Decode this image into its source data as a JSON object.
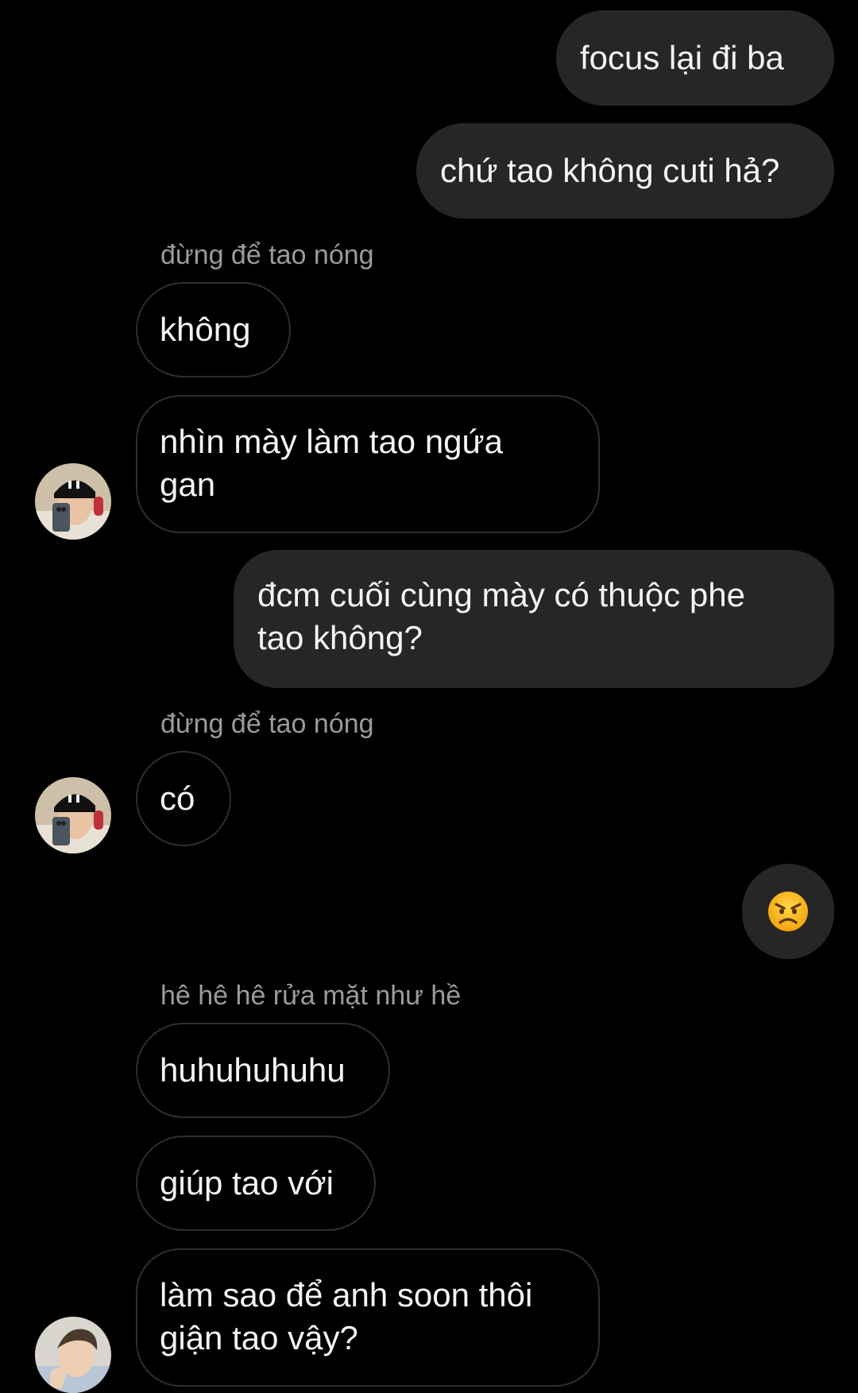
{
  "chat": {
    "messages": [
      {
        "id": "m1",
        "direction": "outgoing",
        "text": "focus lại đi ba"
      },
      {
        "id": "m2",
        "direction": "outgoing",
        "text": "chứ tao không cuti hả?"
      },
      {
        "id": "m3",
        "direction": "incoming",
        "sender": "đừng để tao nóng",
        "text": "không"
      },
      {
        "id": "m4",
        "direction": "incoming",
        "text_line1": "nhìn mày làm tao ngứa",
        "text_line2": "gan"
      },
      {
        "id": "m5",
        "direction": "outgoing",
        "text_line1": "đcm cuối cùng mày có thuộc phe",
        "text_line2": "tao không?"
      },
      {
        "id": "m6",
        "direction": "incoming",
        "sender": "đừng để tao nóng",
        "text": "có"
      },
      {
        "id": "m7",
        "direction": "outgoing",
        "type": "emoji",
        "emoji": "angry-face-emoji"
      },
      {
        "id": "m8",
        "direction": "incoming",
        "sender": "hê hê hê rửa mặt như hề",
        "text": "huhuhuhuhu"
      },
      {
        "id": "m9",
        "direction": "incoming",
        "text": "giúp tao với"
      },
      {
        "id": "m10",
        "direction": "incoming",
        "text_line1": "làm sao để anh soon thôi",
        "text_line2": "giận tao vậy?"
      }
    ]
  },
  "colors": {
    "background": "#000000",
    "outgoing_bubble": "#262626",
    "incoming_border": "#2e2e2e",
    "sender_label": "#9b9b9b",
    "text": "#f4f4f4"
  }
}
